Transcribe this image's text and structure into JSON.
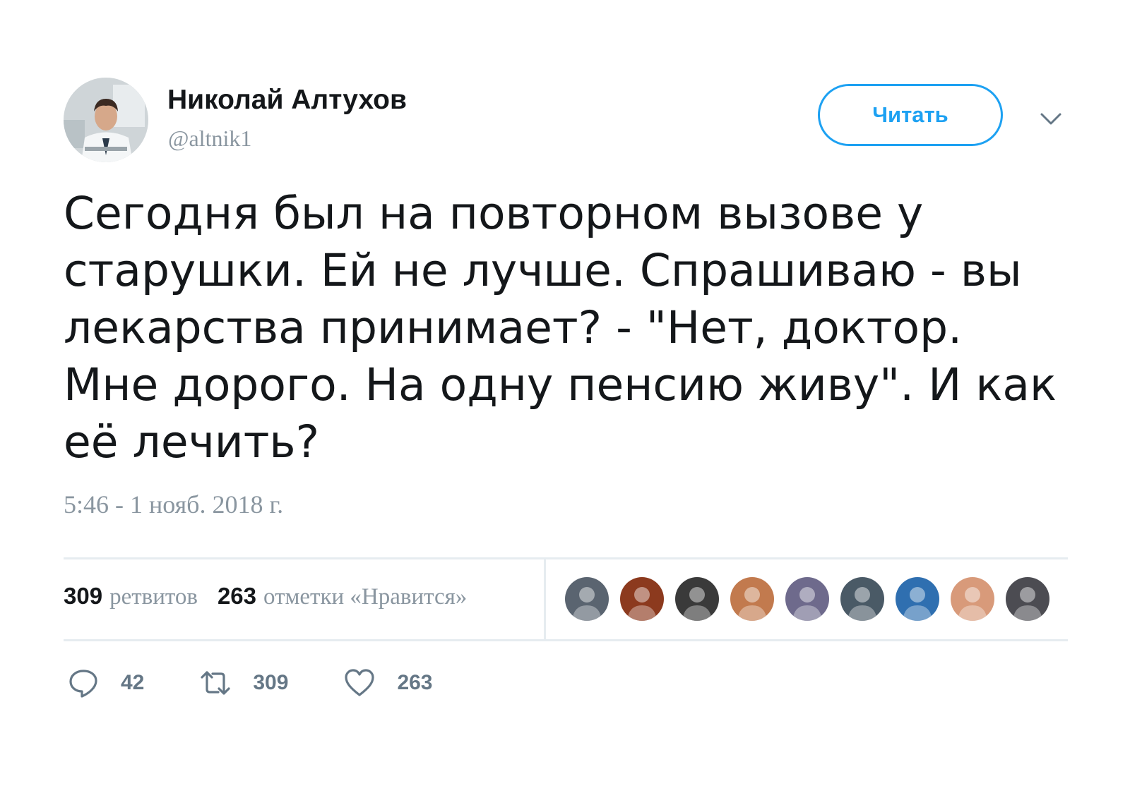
{
  "tweet": {
    "author": {
      "name": "Николай Алтухов",
      "handle": "@altnik1",
      "avatar_icon": "doctor-avatar"
    },
    "follow_label": "Читать",
    "more_icon": "chevron-down-icon",
    "text": "Сегодня был на повторном вызове у старушки. Ей не лучше. Спрашиваю - вы лекарства принимает? - \"Нет, доктор. Мне дорого. На одну пенсию живу\". И как её лечить?",
    "timestamp": "5:46 - 1 нояб. 2018 г.",
    "stats": {
      "retweets_count": "309",
      "retweets_label": "ретвитов",
      "likes_count": "263",
      "likes_label": "отметки «Нравится»"
    },
    "liker_avatars": [
      {
        "icon": "user-avatar",
        "color": "#5a6470"
      },
      {
        "icon": "user-avatar",
        "color": "#8c3a1e"
      },
      {
        "icon": "user-avatar",
        "color": "#3a3a3a"
      },
      {
        "icon": "user-avatar",
        "color": "#c27a4e"
      },
      {
        "icon": "user-avatar",
        "color": "#6e6a8c"
      },
      {
        "icon": "user-avatar",
        "color": "#4a5a66"
      },
      {
        "icon": "user-avatar",
        "color": "#2f6fb0"
      },
      {
        "icon": "user-avatar",
        "color": "#d89a7a"
      },
      {
        "icon": "user-avatar",
        "color": "#4c4c52"
      }
    ],
    "actions": {
      "reply_icon": "reply-icon",
      "reply_count": "42",
      "retweet_icon": "retweet-icon",
      "retweet_count": "309",
      "like_icon": "heart-icon",
      "like_count": "263"
    },
    "colors": {
      "accent": "#1da1f2",
      "muted": "#8a96a0",
      "text": "#14171a",
      "divider": "#e6ecf0",
      "action": "#657786"
    }
  }
}
